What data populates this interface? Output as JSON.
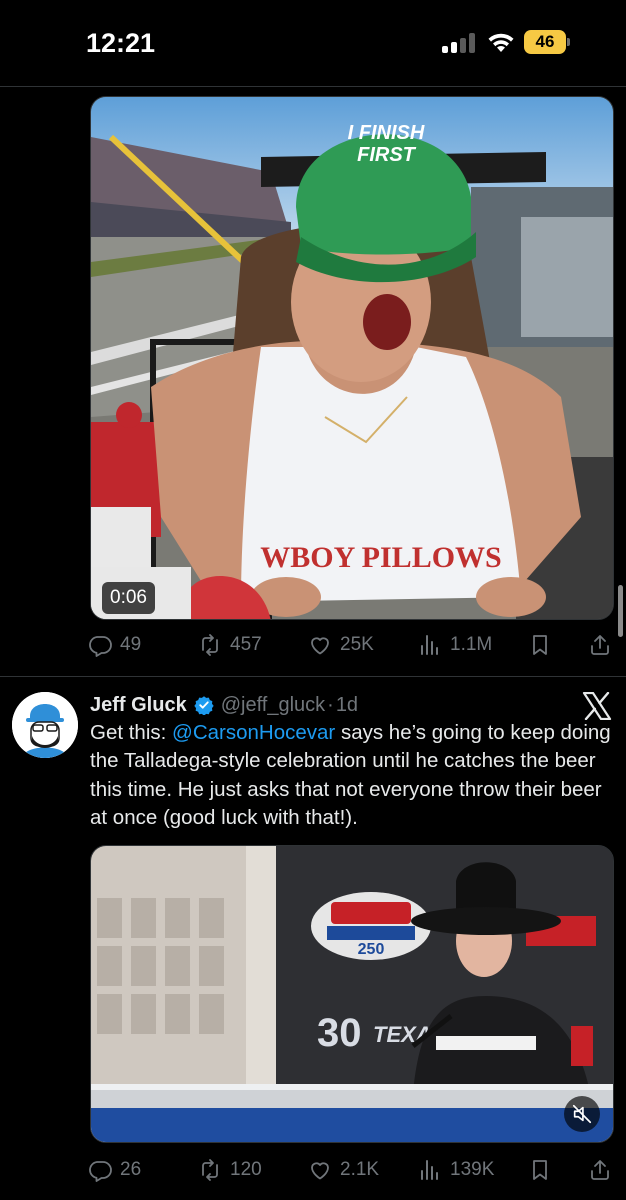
{
  "status_bar": {
    "time": "12:21",
    "battery_level": "46",
    "battery_color": "#f6c944"
  },
  "tweet1": {
    "video": {
      "duration": "0:06"
    },
    "stats": {
      "replies": "49",
      "reposts": "457",
      "likes": "25K",
      "views": "1.1M"
    }
  },
  "tweet2": {
    "author": {
      "name": "Jeff Gluck",
      "handle": "@jeff_gluck",
      "separator": "·",
      "time": "1d",
      "verified": true
    },
    "text": {
      "before": "Get this: ",
      "mention": "@CarsonHocevar",
      "after": " says he’s going to keep doing the Talladega-style celebration until he catches the beer this time. He just asks that not everyone throw their beer at once (good luck with that!)."
    },
    "stats": {
      "replies": "26",
      "reposts": "120",
      "likes": "2.1K",
      "views": "139K"
    }
  },
  "icons": {
    "reply": "reply-icon",
    "repost": "repost-icon",
    "like": "heart-icon",
    "views": "views-icon",
    "bookmark": "bookmark-icon",
    "share": "share-icon",
    "mute": "speaker-muted-icon",
    "verified": "verified-badge-icon",
    "platform": "x-logo-icon"
  },
  "colors": {
    "background": "#000000",
    "text": "#e7e9ea",
    "muted": "#71767b",
    "link": "#1d9bf0",
    "divider": "#2f3336"
  }
}
